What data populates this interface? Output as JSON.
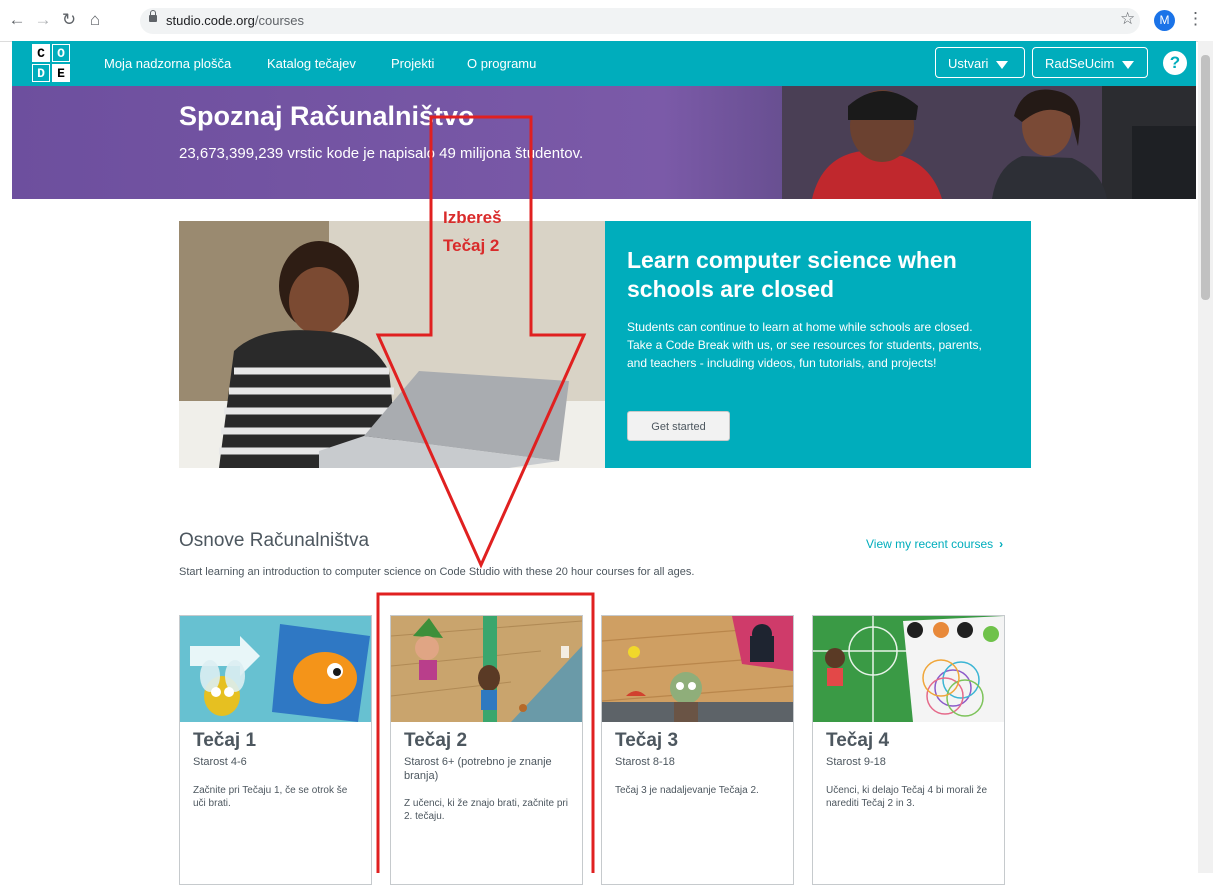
{
  "browser": {
    "url_host": "studio.code.org",
    "url_path": "/courses",
    "avatar_letter": "M"
  },
  "header": {
    "logo_letters": [
      "C",
      "O",
      "D",
      "E"
    ],
    "nav": [
      "Moja nadzorna plošča",
      "Katalog tečajev",
      "Projekti",
      "O programu"
    ],
    "create_label": "Ustvari",
    "user_label": "RadSeUcim",
    "help": "?"
  },
  "banner": {
    "title": "Spoznaj Računalništvo",
    "subtitle": "23,673,399,239 vrstic kode je napisalo 49 milijona študentov."
  },
  "codebreak": {
    "title": "Learn computer science when schools are closed",
    "text": "Students can continue to learn at home while schools are closed. Take a Code Break with us, or see resources for students, parents, and teachers - including videos, fun tutorials, and projects!",
    "button": "Get started"
  },
  "courses_section": {
    "title": "Osnove Računalništva",
    "description": "Start learning an introduction to computer science on Code Studio with these 20 hour courses for all ages.",
    "recent_link": "View my recent courses",
    "cards": [
      {
        "title": "Tečaj 1",
        "age": "Starost 4-6",
        "desc": "Začnite pri Tečaju 1, če se otrok še uči brati."
      },
      {
        "title": "Tečaj 2",
        "age": "Starost 6+ (potrebno je znanje branja)",
        "desc": "Z učenci, ki že znajo brati, začnite pri 2. tečaju."
      },
      {
        "title": "Tečaj 3",
        "age": "Starost 8-18",
        "desc": "Tečaj 3 je nadaljevanje Tečaja 2."
      },
      {
        "title": "Tečaj 4",
        "age": "Starost 9-18",
        "desc": "Učenci, ki delajo Tečaj 4 bi morali že narediti Tečaj 2 in 3."
      }
    ]
  },
  "annotation": {
    "line1": "Izbereš",
    "line2": "Tečaj 2",
    "color": "#e02020"
  },
  "colors": {
    "brand_teal": "#00adbc",
    "banner_purple": "#6d4f9e"
  }
}
